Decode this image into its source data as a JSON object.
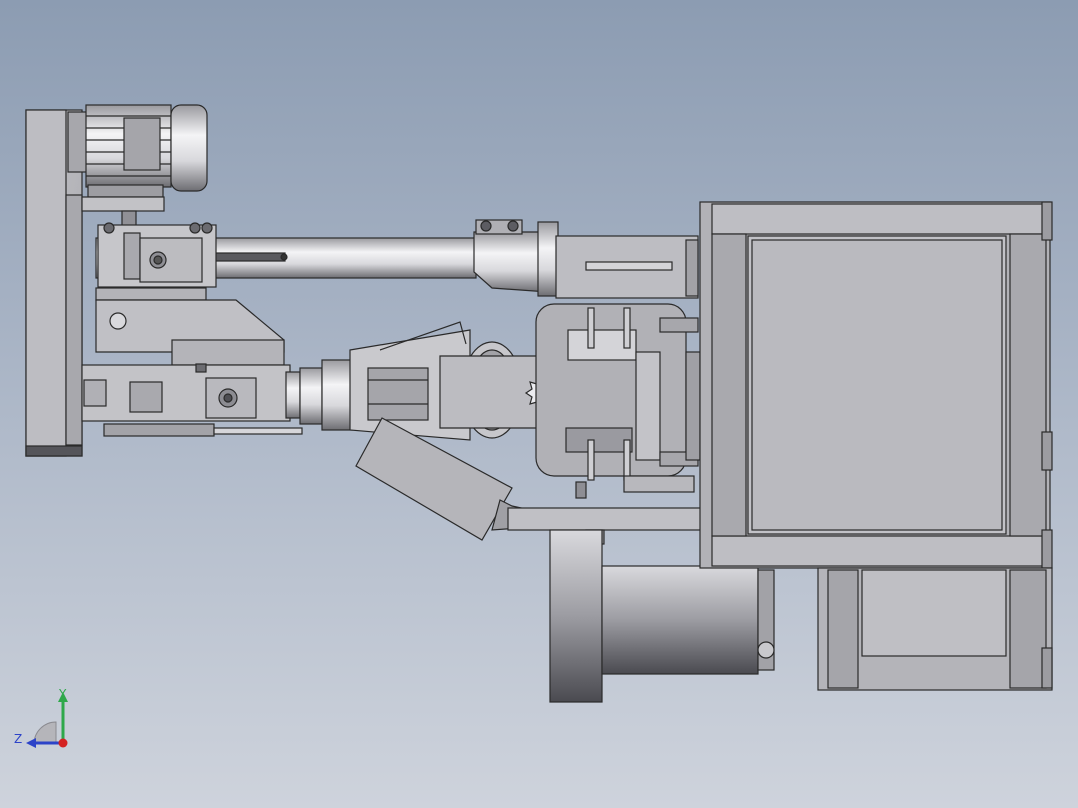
{
  "scene": {
    "background_top": "#8c9cb2",
    "background_bottom": "#ced3dc",
    "model_outline": "#2a2a2a",
    "model_face": "#b7b7bc"
  },
  "view_triad": {
    "y_label": "Y",
    "z_label": "Z",
    "y_color": "#2ea84a",
    "z_color": "#2c43c8",
    "origin_color": "#d42222"
  }
}
